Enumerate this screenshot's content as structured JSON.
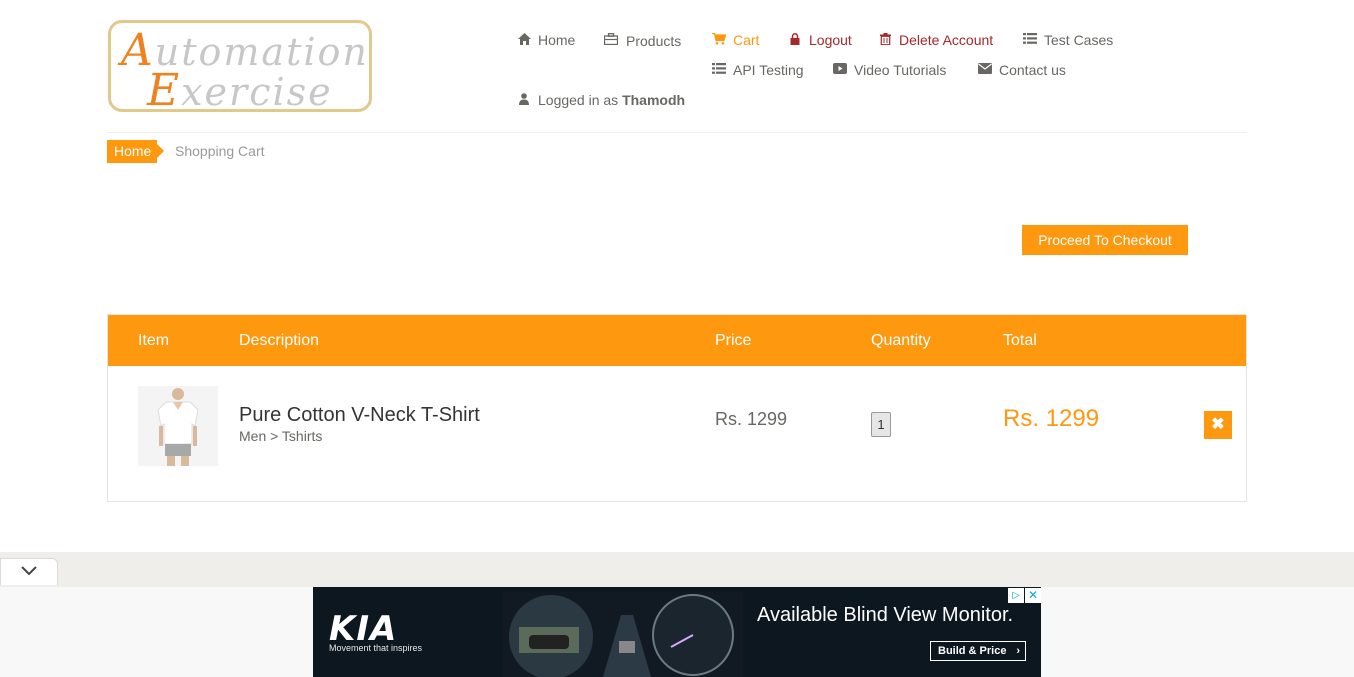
{
  "logo": {
    "line1_first": "A",
    "line1_rest": "utomation",
    "line2_first": "E",
    "line2_rest": "xercise"
  },
  "nav": {
    "home": "Home",
    "products": "Products",
    "cart": "Cart",
    "logout": "Logout",
    "delete_account": "Delete Account",
    "test_cases": "Test Cases",
    "api_testing": "API Testing",
    "video_tutorials": "Video Tutorials",
    "contact_us": "Contact us",
    "logged_in_prefix": "Logged in as",
    "username": "Thamodh"
  },
  "breadcrumb": {
    "home": "Home",
    "current": "Shopping Cart"
  },
  "checkout_button": "Proceed To Checkout",
  "cart": {
    "headers": {
      "item": "Item",
      "description": "Description",
      "price": "Price",
      "quantity": "Quantity",
      "total": "Total"
    },
    "rows": [
      {
        "name": "Pure Cotton V-Neck T-Shirt",
        "category": "Men > Tshirts",
        "price": "Rs. 1299",
        "quantity": "1",
        "total": "Rs. 1299"
      }
    ]
  },
  "ad": {
    "brand": "KIA",
    "tagline": "Movement that inspires",
    "headline": "Available Blind View Monitor.",
    "cta": "Build & Price"
  },
  "colors": {
    "accent": "#fe980f",
    "danger": "#a5282a",
    "text": "#696763"
  },
  "icons": {
    "home": "home-icon",
    "products": "briefcase-icon",
    "cart": "shopping-cart-icon",
    "logout": "lock-icon",
    "delete": "trash-icon",
    "list": "list-icon",
    "video": "youtube-play-icon",
    "contact": "envelope-icon",
    "user": "user-icon",
    "remove": "times-icon",
    "collapse": "chevron-down-icon"
  }
}
